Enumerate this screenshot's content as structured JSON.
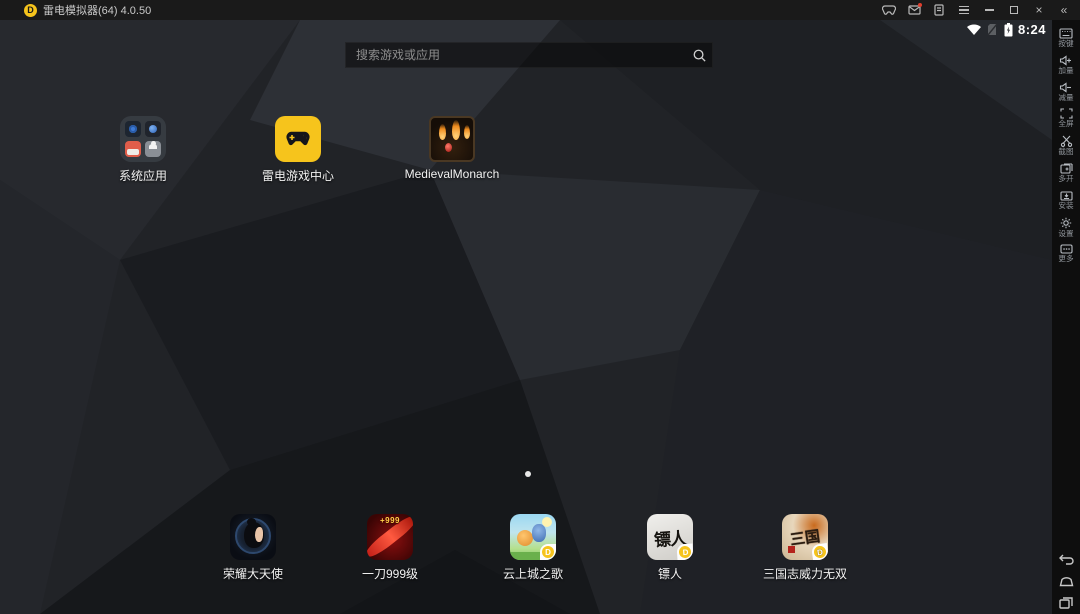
{
  "titlebar": {
    "title": "雷电模拟器(64) 4.0.50",
    "logo_letter": "D",
    "close_glyph": "×",
    "collapse_glyph": "«"
  },
  "status": {
    "time": "8:24"
  },
  "search": {
    "placeholder": "搜索游戏或应用"
  },
  "home": {
    "apps": [
      {
        "label": "系统应用"
      },
      {
        "label": "雷电游戏中心"
      },
      {
        "label": "MedievalMonarch"
      }
    ],
    "page_dots": 1
  },
  "dock": {
    "apps": [
      {
        "label": "荣耀大天使"
      },
      {
        "label": "一刀999级",
        "icon_badge": "+999"
      },
      {
        "label": "云上城之歌",
        "corner_badge": "D"
      },
      {
        "label": "镖人",
        "icon_text": "镖人",
        "corner_badge": "D"
      },
      {
        "label": "三国志威力无双",
        "icon_text": "三国",
        "corner_badge": "D"
      }
    ]
  },
  "sidebar": {
    "items": [
      {
        "label": "按键"
      },
      {
        "label": "加量"
      },
      {
        "label": "减量"
      },
      {
        "label": "全屏"
      },
      {
        "label": "截图"
      },
      {
        "label": "多开"
      },
      {
        "label": "安装"
      },
      {
        "label": "设置"
      },
      {
        "label": "更多"
      }
    ]
  },
  "colors": {
    "accent_yellow": "#f6c41c",
    "titlebar_bg": "#1a1a1a",
    "sidebar_bg": "#0e0e0e",
    "wallpaper_base": "#212327",
    "notification_red": "#e03e2d"
  }
}
